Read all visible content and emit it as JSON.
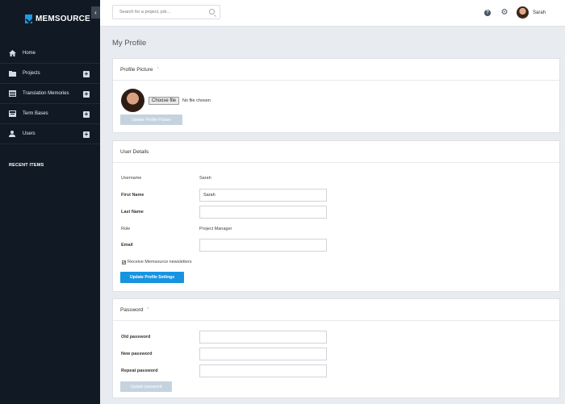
{
  "sidebar": {
    "logo": "MEMSOURCE",
    "collapse_icon": "chevron-left-icon",
    "items": [
      {
        "label": "Home",
        "icon": "home-icon",
        "has_add": false
      },
      {
        "label": "Projects",
        "icon": "folder-icon",
        "has_add": true
      },
      {
        "label": "Translation Memories",
        "icon": "database-icon",
        "has_add": true
      },
      {
        "label": "Term Bases",
        "icon": "book-icon",
        "has_add": true
      },
      {
        "label": "Users",
        "icon": "user-icon",
        "has_add": true
      }
    ],
    "add_label": "+",
    "recent_items": "RECENT ITEMS"
  },
  "header": {
    "search_placeholder": "Search for a project, job...",
    "help_icon": "?",
    "gear_icon": "⚙",
    "user_name": "Sarah"
  },
  "page": {
    "title": "My Profile"
  },
  "profile_picture": {
    "heading": "Profile Picture",
    "chevron": "⌃",
    "choose_file": "Choose file",
    "no_file": "No file chosen",
    "update_button": "Update Profile Picture"
  },
  "user_details": {
    "heading": "User Details",
    "username_label": "Username",
    "username_value": "Sarah",
    "first_name_label": "First Name",
    "first_name_value": "Sarah",
    "last_name_label": "Last Name",
    "last_name_value": "",
    "role_label": "Role",
    "role_value": "Project Manager",
    "email_label": "Email",
    "email_value": "",
    "newsletter_label": "Receive Memsource newsletters",
    "newsletter_checked": true,
    "update_button": "Update Profile Settings"
  },
  "password": {
    "heading": "Password",
    "chevron": "⌃",
    "old_label": "Old password",
    "new_label": "New password",
    "repeat_label": "Repeat password",
    "update_button": "Update password"
  },
  "colors": {
    "sidebar_bg": "#111a24",
    "accent": "#1794e0",
    "disabled_button": "#c5d3df",
    "page_bg": "#e8ebef"
  }
}
